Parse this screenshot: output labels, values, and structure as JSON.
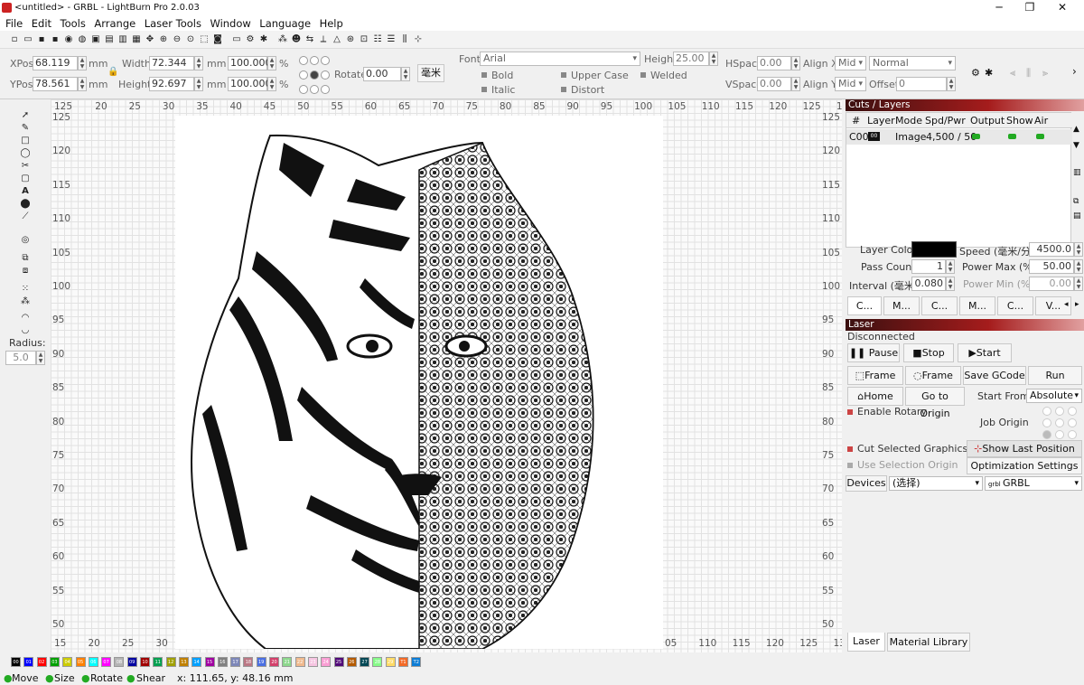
{
  "window": {
    "title": "<untitled> - GRBL - LightBurn Pro 2.0.03"
  },
  "menu": [
    "File",
    "Edit",
    "Tools",
    "Arrange",
    "Laser Tools",
    "Window",
    "Language",
    "Help"
  ],
  "props": {
    "xpos_label": "XPos",
    "xpos": "68.119",
    "ypos_label": "YPos",
    "ypos": "78.561",
    "unit": "mm",
    "width_label": "Width",
    "width": "72.344",
    "height_label": "Height",
    "height": "92.697",
    "pct_w": "100.000",
    "pct_h": "100.000",
    "pct": "%",
    "rotate_label": "Rotate",
    "rotate": "0.00",
    "unit_btn": "毫米"
  },
  "text": {
    "font_label": "Font",
    "font": "Arial",
    "height_label": "Height",
    "height": "25.00",
    "hspace_label": "HSpace",
    "hspace": "0.00",
    "vspace_label": "VSpace",
    "vspace": "0.00",
    "alignx_label": "Align X",
    "alignx": "Mid",
    "aligny_label": "Align Y",
    "aligny": "Mid",
    "normal": "Normal",
    "offset_label": "Offset",
    "offset": "0",
    "bold": "Bold",
    "italic": "Italic",
    "upper": "Upper Case",
    "distort": "Distort",
    "welded": "Welded"
  },
  "ruler": {
    "top": [
      "125",
      "20",
      "25",
      "30",
      "35",
      "40",
      "45",
      "50",
      "55",
      "60",
      "65",
      "70",
      "75",
      "80",
      "85",
      "90",
      "95",
      "100",
      "105",
      "110",
      "115",
      "120",
      "125",
      "130"
    ],
    "bottom": [
      "15",
      "20",
      "25",
      "30",
      "05",
      "110",
      "115",
      "120",
      "125",
      "130"
    ],
    "left": [
      "125",
      "120",
      "115",
      "110",
      "105",
      "100",
      "95",
      "90",
      "85",
      "80",
      "75",
      "70",
      "65",
      "60",
      "55",
      "50"
    ],
    "right": [
      "125",
      "120",
      "115",
      "110",
      "105",
      "100",
      "95",
      "90",
      "85",
      "80",
      "75",
      "70",
      "65",
      "60",
      "55",
      "50"
    ]
  },
  "left": {
    "radius_label": "Radius:",
    "radius": "5.0"
  },
  "cuts": {
    "header": "Cuts / Layers",
    "cols": [
      "#",
      "Layer",
      "Mode",
      "Spd/Pwr",
      "Output",
      "Show",
      "Air"
    ],
    "row": {
      "num": "C00",
      "layer": "00",
      "mode": "Image",
      "spdpwr": "4,500 / 50"
    },
    "layer_color_label": "Layer Color",
    "speed_label": "Speed (毫米/分)",
    "speed": "4500.0",
    "pass_label": "Pass Count",
    "pass": "1",
    "powmax_label": "Power Max (%)",
    "powmax": "50.00",
    "interval_label": "Interval (毫米)",
    "interval": "0.080",
    "powmin_label": "Power Min (%)",
    "powmin": "0.00",
    "tabs": [
      "C...",
      "M...",
      "C...",
      "M...",
      "C...",
      "V..."
    ]
  },
  "laser": {
    "header": "Laser",
    "status": "Disconnected",
    "pause": "Pause",
    "stop": "Stop",
    "start": "Start",
    "frame1": "Frame",
    "frame2": "Frame",
    "save": "Save GCode",
    "run": "Run GCode",
    "home": "Home",
    "origin": "Go to Origin",
    "startfrom_label": "Start From:",
    "startfrom": "Absolute",
    "rotary": "Enable Rotary",
    "joborigin": "Job Origin",
    "cutsel": "Cut Selected Graphics",
    "usesel": "Use Selection Origin",
    "showlast": "Show Last Position",
    "optim": "Optimization Settings",
    "devices": "Devices",
    "select": "(选择)",
    "device": "GRBL",
    "tab_laser": "Laser",
    "tab_material": "Material Library"
  },
  "palette": [
    "00",
    "01",
    "02",
    "03",
    "04",
    "05",
    "06",
    "07",
    "08",
    "09",
    "10",
    "11",
    "12",
    "13",
    "14",
    "15",
    "16",
    "17",
    "18",
    "19",
    "20",
    "21",
    "22",
    "23",
    "24",
    "25",
    "26",
    "27",
    "28",
    "29",
    "T1",
    "T2"
  ],
  "palette_colors": [
    "#000000",
    "#0000ff",
    "#ff0000",
    "#00a000",
    "#cccc00",
    "#ff8000",
    "#00ffff",
    "#ff00ff",
    "#b4b4b4",
    "#0000a0",
    "#a00000",
    "#00a050",
    "#a0a000",
    "#c08000",
    "#00a0ff",
    "#a000a0",
    "#808080",
    "#7d87b9",
    "#bb7784",
    "#4a6fe3",
    "#d33f6a",
    "#8cd78c",
    "#f0b98d",
    "#f6c4e1",
    "#fa9ed4",
    "#500a78",
    "#b45a00",
    "#004754",
    "#86fa88",
    "#ffdb66",
    "#f36926",
    "#0c7cd5"
  ],
  "status": {
    "move": "Move",
    "size": "Size",
    "rotate": "Rotate",
    "shear": "Shear",
    "coords": "x: 111.65, y: 48.16 mm"
  }
}
